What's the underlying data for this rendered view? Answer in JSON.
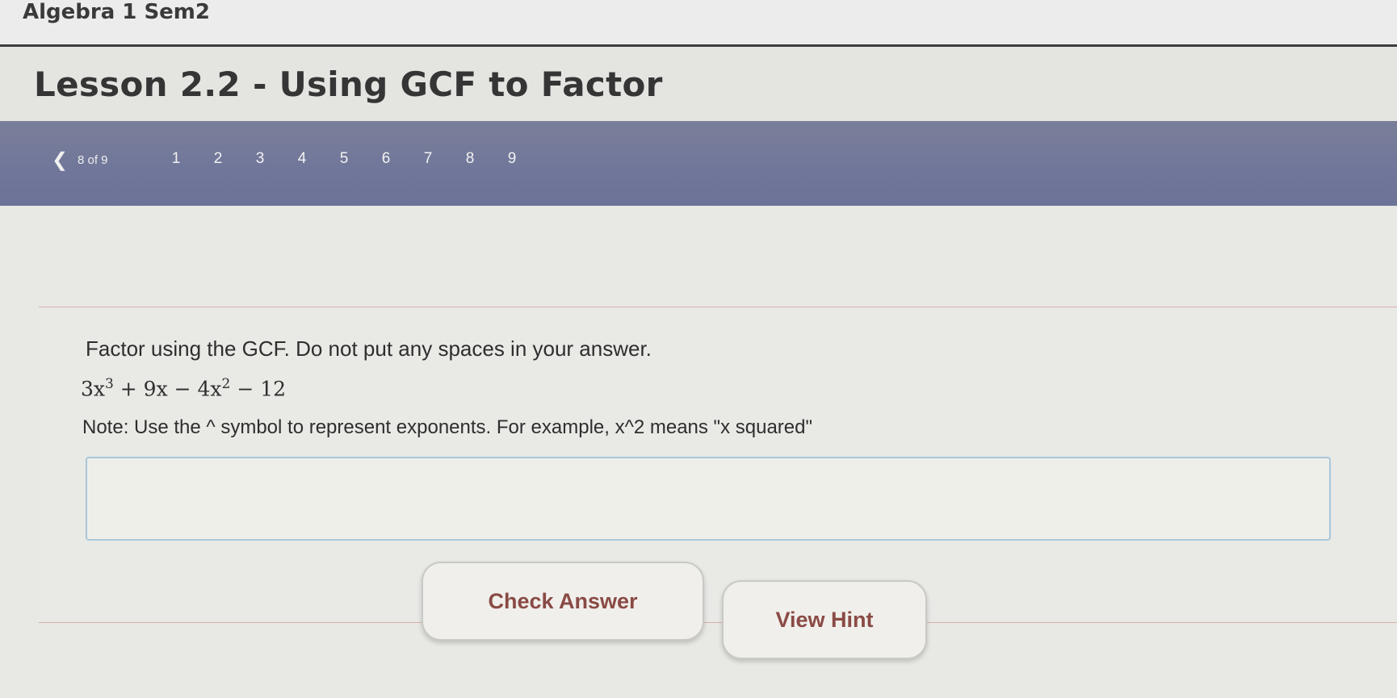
{
  "course": {
    "title": "Algebra 1 Sem2"
  },
  "lesson": {
    "title": "Lesson 2.2 - Using GCF to Factor"
  },
  "nav": {
    "prev_icon": "chevron-left-icon",
    "prev_glyph": "❮",
    "counter": "8 of 9",
    "current_page": 8,
    "pages": [
      "1",
      "2",
      "3",
      "4",
      "5",
      "6",
      "7",
      "8",
      "9"
    ]
  },
  "question": {
    "instructions": "Factor using the GCF. Do not put any spaces in your answer.",
    "expression": {
      "t1_base": "3x",
      "t1_exp": "3",
      "t2": " + 9x − 4x",
      "t2_exp": "2",
      "t3": " − 12"
    },
    "note": "Note: Use the ^ symbol to represent exponents. For example, x^2 means \"x squared\""
  },
  "answer": {
    "value": "",
    "placeholder": ""
  },
  "buttons": {
    "check_label": "Check Answer",
    "hint_label": "View Hint"
  }
}
